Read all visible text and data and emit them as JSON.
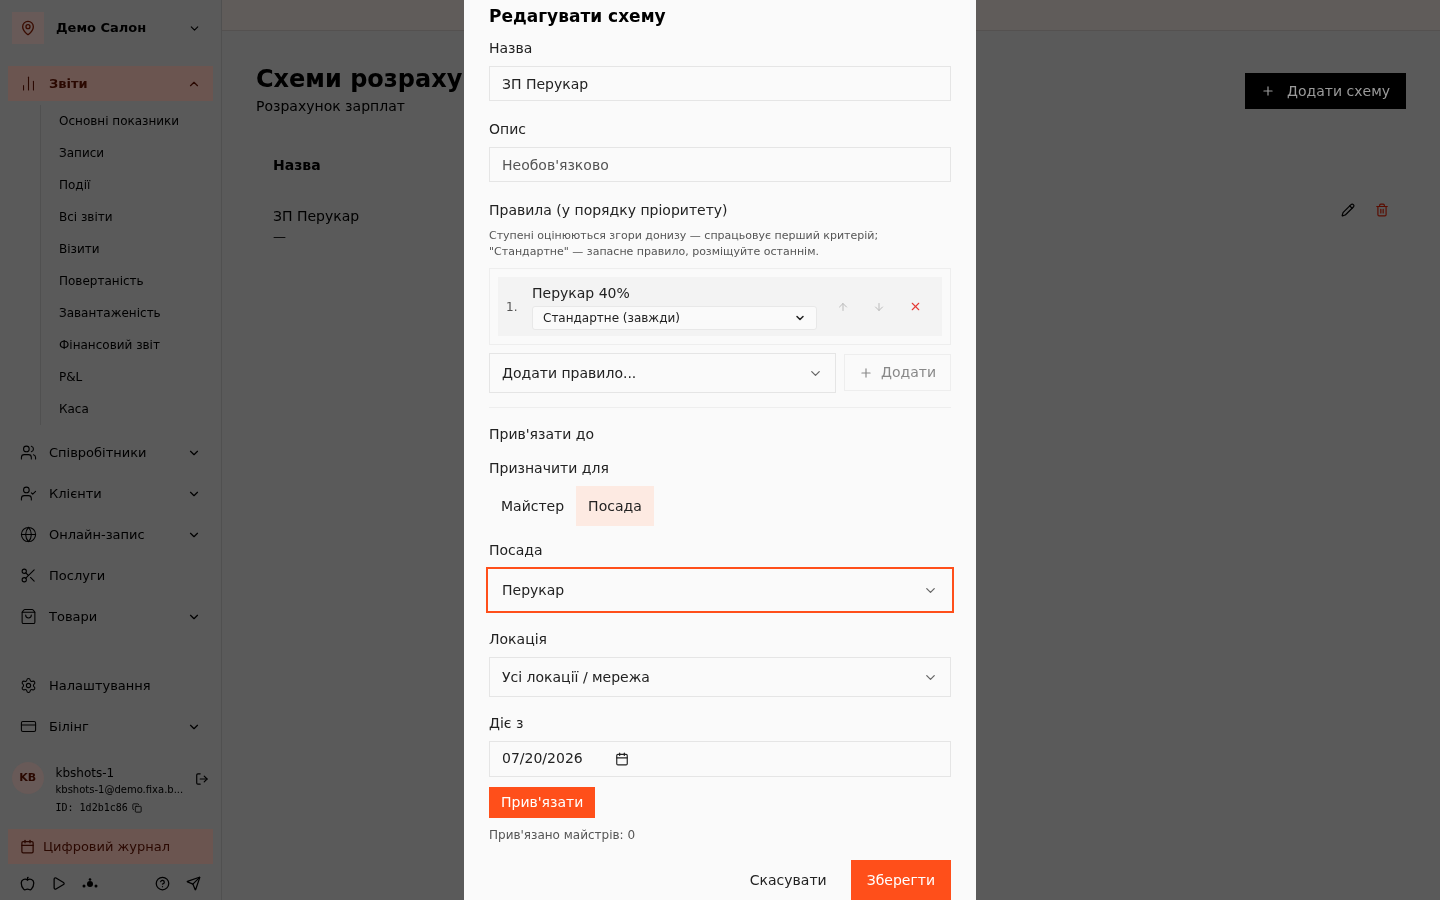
{
  "sidebar": {
    "location": "Демо Салон",
    "nav": [
      {
        "label": "Звіти",
        "selected": true,
        "expanded": true,
        "children": [
          {
            "label": "Основні показники"
          },
          {
            "label": "Записи"
          },
          {
            "label": "Події"
          },
          {
            "label": "Всі звіти"
          },
          {
            "label": "Візити"
          },
          {
            "label": "Повертаність"
          },
          {
            "label": "Завантаженість"
          },
          {
            "label": "Фінансовий звіт"
          },
          {
            "label": "P&L"
          },
          {
            "label": "Каса"
          }
        ]
      },
      {
        "label": "Співробітники",
        "selected": false,
        "expanded": false
      },
      {
        "label": "Клієнти",
        "selected": false,
        "expanded": false
      },
      {
        "label": "Онлайн-запис",
        "selected": false,
        "expanded": false
      },
      {
        "label": "Послуги",
        "selected": false
      },
      {
        "label": "Товари",
        "selected": false,
        "expanded": false
      },
      {
        "label": "Налаштування",
        "selected": false
      },
      {
        "label": "Білінг",
        "selected": false,
        "expanded": false
      }
    ],
    "user": {
      "initials": "KB",
      "name": "kbshots-1",
      "email": "kbshots-1@demo.fixa.b...",
      "id": "ID: 1d2b1c86"
    },
    "journal": "Цифровий журнал"
  },
  "main": {
    "title": "Схеми розраху",
    "subtitle": "Розрахунок зарплат",
    "add_button": "Додати схему",
    "table": {
      "columns": [
        "Назва"
      ],
      "rows": [
        {
          "name": "ЗП Перукар",
          "description": "—"
        }
      ]
    }
  },
  "modal": {
    "title": "Редагувати схему",
    "name": {
      "label": "Назва",
      "value": "ЗП Перукар"
    },
    "description": {
      "label": "Опис",
      "placeholder": "Необов'язково"
    },
    "rules": {
      "label": "Правила (у порядку пріоритету)",
      "hint": "Ступені оцінюються згори донизу — спрацьовує перший критерій; \"Стандартне\" — запасне правило, розміщуйте останнім.",
      "items": [
        {
          "number": "1.",
          "name": "Перукар 40%",
          "condition": "Стандартне (завжди)"
        }
      ],
      "add_select": "Додати правило...",
      "add_button": "Додати"
    },
    "bind": {
      "label": "Прив'язати до",
      "assign_label": "Призначити для",
      "options": [
        {
          "label": "Майстер",
          "selected": false
        },
        {
          "label": "Посада",
          "selected": true
        }
      ],
      "position": {
        "label": "Посада",
        "value": "Перукар",
        "focused": true
      },
      "location": {
        "label": "Локація",
        "value": "Усі локації / мережа",
        "focused": false
      },
      "date": {
        "label": "Діє з",
        "value": "07/20/2026"
      },
      "button": "Прив'язати",
      "count": "Прив'язано майстрів: 0"
    },
    "cancel": "Скасувати",
    "save": "Зберегти"
  }
}
